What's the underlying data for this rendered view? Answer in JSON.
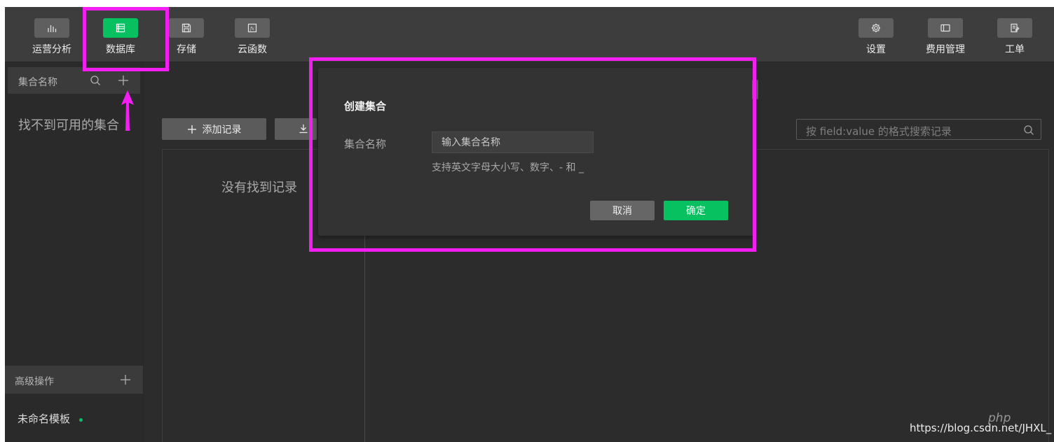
{
  "toolbar": {
    "left_items": [
      {
        "label": "运营分析",
        "icon": "bar-chart-icon"
      },
      {
        "label": "数据库",
        "icon": "database-icon",
        "active": true
      },
      {
        "label": "存储",
        "icon": "storage-icon"
      },
      {
        "label": "云函数",
        "icon": "cloud-function-icon"
      }
    ],
    "right_items": [
      {
        "label": "设置",
        "icon": "gear-icon"
      },
      {
        "label": "费用管理",
        "icon": "billing-icon"
      },
      {
        "label": "工单",
        "icon": "ticket-icon"
      }
    ]
  },
  "sidebar": {
    "collection_header": "集合名称",
    "empty_text": "找不到可用的集合",
    "advanced_header": "高级操作",
    "template_item": "未命名模板"
  },
  "main": {
    "add_record_label": "添加记录",
    "search_placeholder": "按 field:value 的格式搜索记录",
    "no_records_text": "没有找到记录"
  },
  "modal": {
    "title": "创建集合",
    "field_label": "集合名称",
    "input_placeholder": "输入集合名称",
    "input_value": "",
    "hint": "支持英文字母大小写、数字、- 和 _",
    "cancel_label": "取消",
    "confirm_label": "确定"
  },
  "watermark": {
    "php": "php",
    "url": "https://blog.csdn.net/JHXL_"
  },
  "colors": {
    "accent": "#07c160",
    "highlight": "#f21ef2",
    "app_bg": "#2c2c2c",
    "toolbar_bg": "#3d3d3d"
  }
}
